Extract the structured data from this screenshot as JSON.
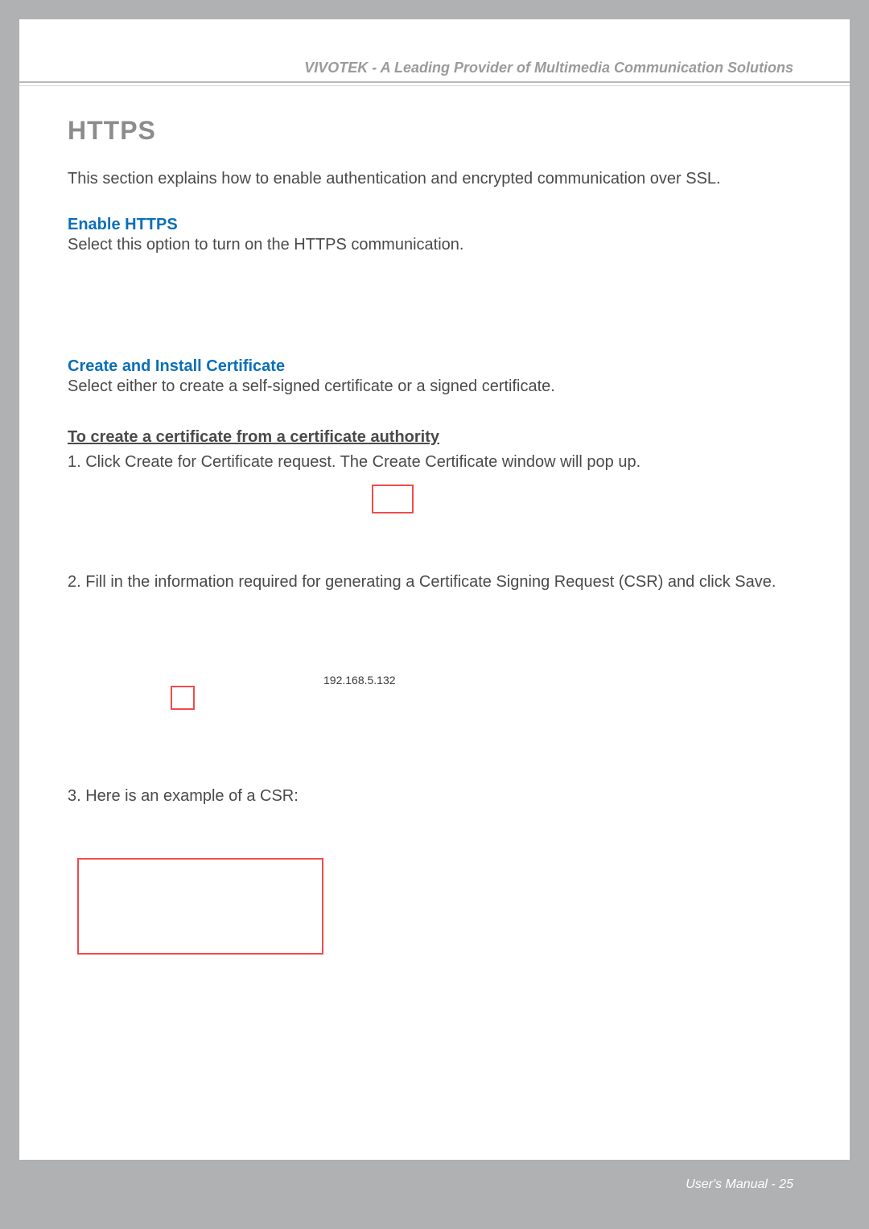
{
  "header": {
    "brand_line": "VIVOTEK - A Leading Provider of Multimedia Communication Solutions"
  },
  "section": {
    "title": "HTTPS",
    "intro": "This section explains how to enable authentication and encrypted communication over SSL."
  },
  "enable": {
    "heading": "Enable HTTPS",
    "desc": "Select this option to turn on the HTTPS communication."
  },
  "create_install": {
    "heading": "Create and Install Certificate",
    "desc": "Select either to create a self-signed certificate or a signed certificate."
  },
  "ca": {
    "heading": "To create a certificate from a certificate authority",
    "step1": "1. Click Create for Certificate request. The Create Certificate window will pop up.",
    "step2": "2. Fill in the information required for generating a Certificate Signing Request (CSR) and click Save.",
    "ip": "192.168.5.132",
    "step3": "3. Here is an example of a CSR:"
  },
  "footer": {
    "label": "User's Manual - ",
    "page": "25"
  }
}
